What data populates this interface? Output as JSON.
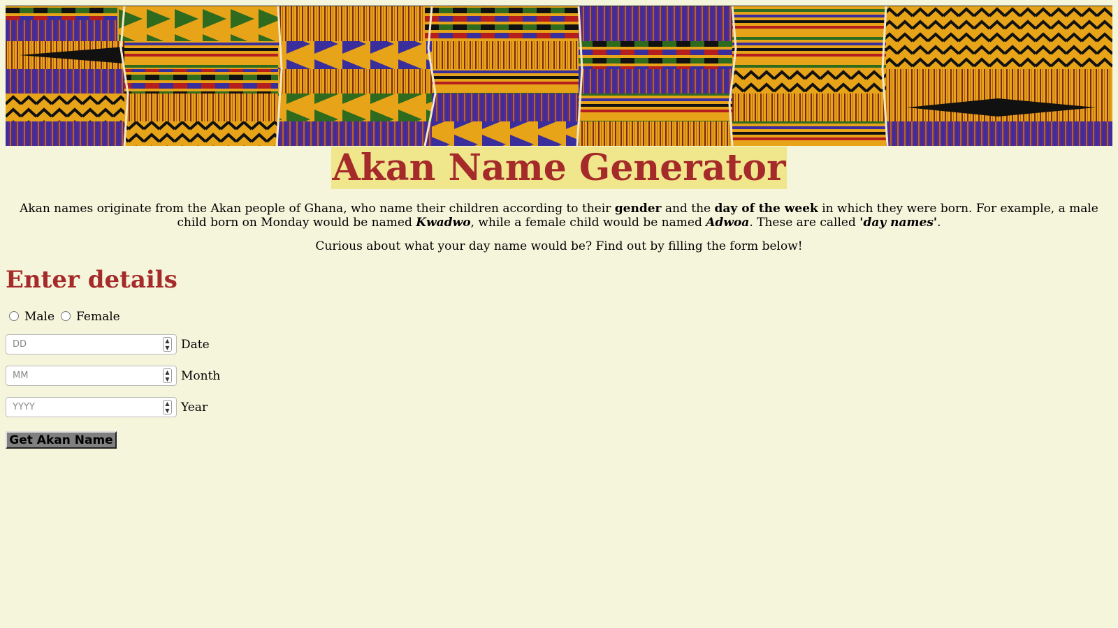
{
  "header": {
    "title": "Akan Name Generator"
  },
  "intro": {
    "p1_a": "Akan names originate from the Akan people of Ghana, who name their children according to their ",
    "p1_gender": "gender",
    "p1_b": " and the ",
    "p1_day": "day of the week",
    "p1_c": " in which they were born. For example, a male child born on Monday would be named ",
    "p1_kwadwo": "Kwadwo",
    "p1_d": ", while a female child would be named ",
    "p1_adwoa": "Adwoa",
    "p1_e": ". These are called ",
    "p1_daynames": "'day names'",
    "p1_f": ".",
    "p2": "Curious about what your day name would be? Find out by filling the form below!"
  },
  "form": {
    "heading": "Enter details",
    "gender_options": [
      "Male",
      "Female"
    ],
    "date_placeholder": "DD",
    "date_label": "Date",
    "month_placeholder": "MM",
    "month_label": "Month",
    "year_placeholder": "YYYY",
    "year_label": "Year",
    "submit_label": "Get Akan Name"
  },
  "colors": {
    "background": "#f5f5dc",
    "heading": "#a52a2a",
    "title_highlight": "#f0e68c",
    "button": "#808080"
  }
}
